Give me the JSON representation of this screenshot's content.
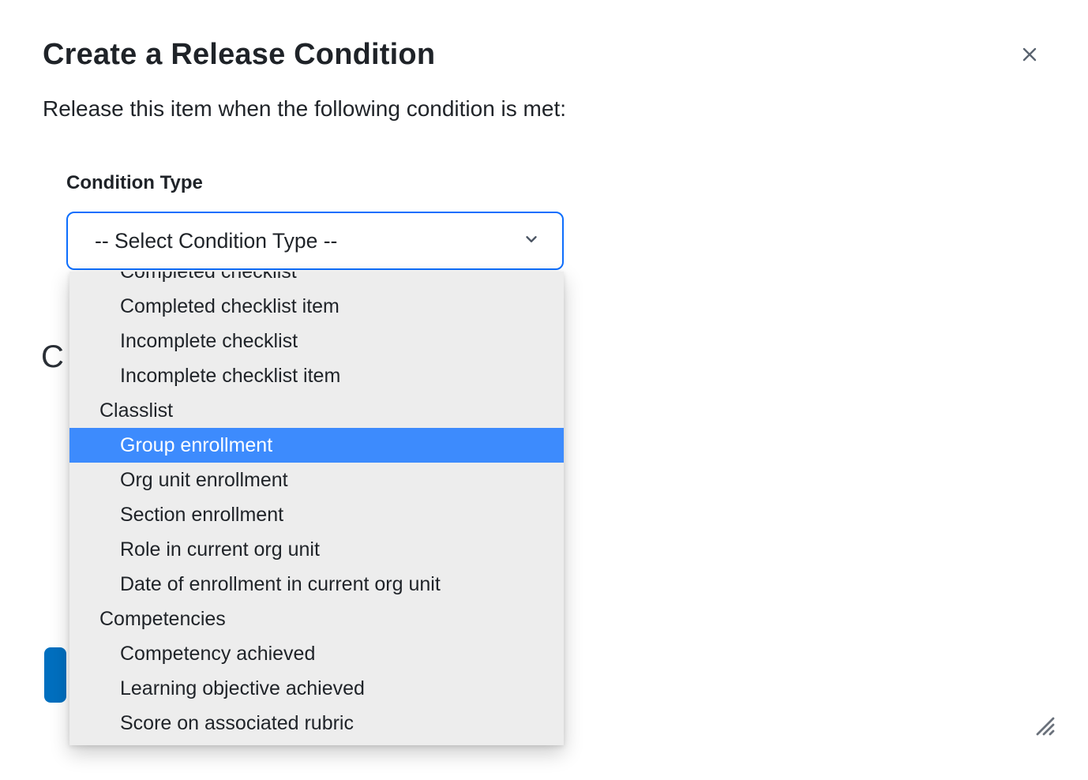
{
  "dialog": {
    "title": "Create a Release Condition",
    "subtitle": "Release this item when the following condition is met:"
  },
  "conditionType": {
    "label": "Condition Type",
    "selected": "-- Select Condition Type --",
    "highlighted": "Group enrollment",
    "visiblePartialTop": "Completed checklist",
    "groups": [
      {
        "name": "",
        "items": [
          "Completed checklist item",
          "Incomplete checklist",
          "Incomplete checklist item"
        ]
      },
      {
        "name": "Classlist",
        "items": [
          "Group enrollment",
          "Org unit enrollment",
          "Section enrollment",
          "Role in current org unit",
          "Date of enrollment in current org unit"
        ]
      },
      {
        "name": "Competencies",
        "items": [
          "Competency achieved",
          "Learning objective achieved",
          "Score on associated rubric"
        ]
      }
    ]
  },
  "behindText": "C"
}
